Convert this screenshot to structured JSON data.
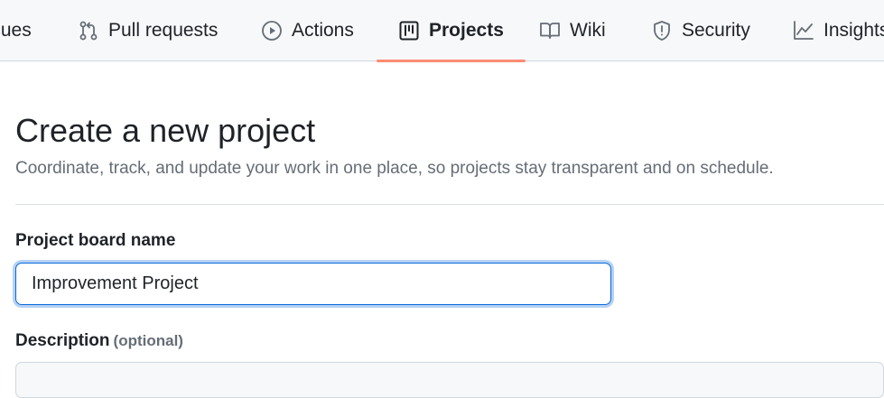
{
  "repo_nav": {
    "tabs": [
      {
        "label": "Issues",
        "icon": "issue-opened-icon"
      },
      {
        "label": "Pull requests",
        "icon": "git-pull-request-icon"
      },
      {
        "label": "Actions",
        "icon": "play-icon"
      },
      {
        "label": "Projects",
        "icon": "table-icon",
        "selected": true
      },
      {
        "label": "Wiki",
        "icon": "book-icon"
      },
      {
        "label": "Security",
        "icon": "shield-icon"
      },
      {
        "label": "Insights",
        "icon": "graph-icon"
      }
    ]
  },
  "main": {
    "title": "Create a new project",
    "subtitle": "Coordinate, track, and update your work in one place, so projects stay transparent and on schedule.",
    "form": {
      "name_label": "Project board name",
      "name_value": "Improvement Project",
      "description_label": "Description",
      "description_optional": "(optional)"
    }
  },
  "colors": {
    "selected_underline": "#fd8c73",
    "focus_border": "#0969da",
    "muted_text": "#656d76"
  }
}
